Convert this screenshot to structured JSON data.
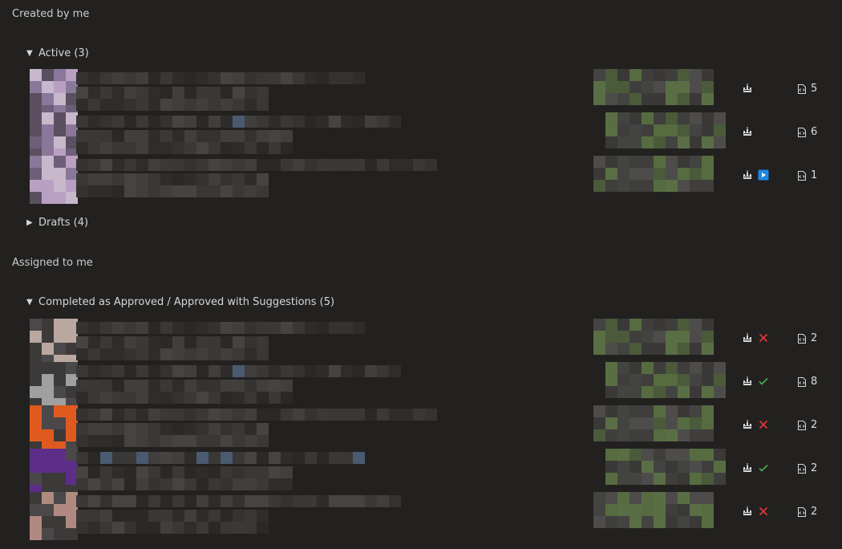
{
  "sections": {
    "created": {
      "title": "Created by me"
    },
    "assigned": {
      "title": "Assigned to me"
    }
  },
  "groups": {
    "active": {
      "label": "Active (3)",
      "expanded": true
    },
    "drafts": {
      "label": "Drafts (4)",
      "expanded": false
    },
    "completed": {
      "label": "Completed as Approved / Approved with Suggestions (5)",
      "expanded": true
    }
  },
  "active_rows": [
    {
      "count": "5",
      "status": "none"
    },
    {
      "count": "6",
      "status": "none"
    },
    {
      "count": "1",
      "status": "active"
    }
  ],
  "completed_rows": [
    {
      "count": "2",
      "status": "rejected",
      "avatar": "#b9a7a0"
    },
    {
      "count": "8",
      "status": "approved",
      "avatar": "#a0a0a0"
    },
    {
      "count": "2",
      "status": "rejected",
      "avatar": "#e05a20"
    },
    {
      "count": "2",
      "status": "approved",
      "avatar": "#5c2e8a"
    },
    {
      "count": "2",
      "status": "rejected",
      "avatar": "#b08a80"
    }
  ],
  "icons": {
    "build": "build-pipeline-icon",
    "file": "code-file-icon",
    "approved": "check-icon",
    "rejected": "x-icon",
    "active": "play-icon"
  },
  "colors": {
    "background": "#222120",
    "approved": "#4caf50",
    "rejected": "#e53935",
    "active_badge": "#1e88e5"
  }
}
